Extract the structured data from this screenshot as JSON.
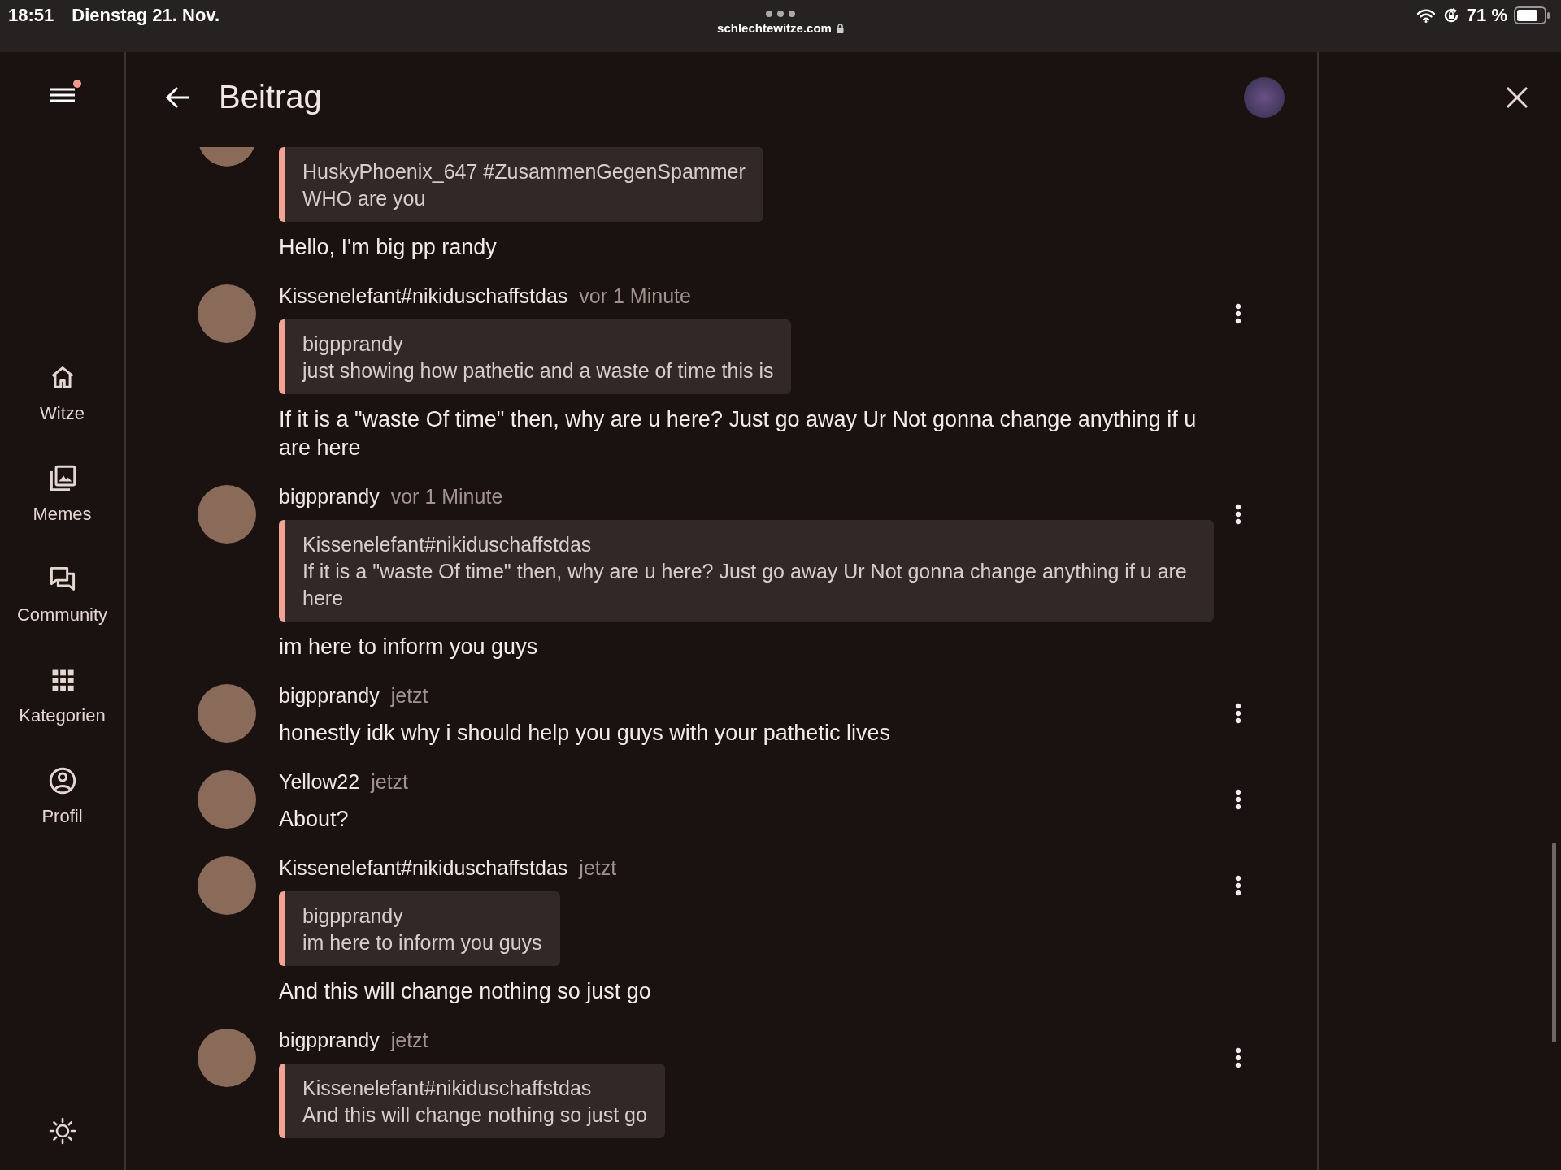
{
  "status_bar": {
    "time": "18:51",
    "date": "Dienstag 21. Nov.",
    "url": "schlechtewitze.com",
    "battery": "71 %"
  },
  "sidebar": {
    "menu_notification": true,
    "items": [
      {
        "kind": "home",
        "label": "Witze",
        "selected": false
      },
      {
        "kind": "memes",
        "label": "Memes",
        "selected": false
      },
      {
        "kind": "community",
        "label": "Community",
        "selected": false
      },
      {
        "kind": "categories",
        "label": "Kategorien",
        "selected": false
      },
      {
        "kind": "profile",
        "label": "Profil",
        "selected": false
      }
    ]
  },
  "header": {
    "title": "Beitrag"
  },
  "comments": [
    {
      "kind": "continued",
      "quote": {
        "author": "HuskyPhoenix_647 #ZusammenGegenSpammer",
        "text": "WHO are you"
      },
      "body": "Hello, I'm big pp randy"
    },
    {
      "kind": "comment",
      "author": "Kissenelefant#nikiduschaffstdas",
      "time": "vor 1 Minute",
      "quote": {
        "author": "bigpprandy",
        "text": "just showing how pathetic and a waste of time this is"
      },
      "body": "If it is a \"waste Of time\" then, why are u here? Just go away Ur Not gonna change anything if u are here"
    },
    {
      "kind": "comment",
      "author": "bigpprandy",
      "time": "vor 1 Minute",
      "quote": {
        "author": "Kissenelefant#nikiduschaffstdas",
        "text": "If it is a \"waste Of time\" then, why are u here? Just go away Ur Not gonna change anything if u are here"
      },
      "body": "im here to inform you guys"
    },
    {
      "kind": "comment",
      "author": "bigpprandy",
      "time": "jetzt",
      "body": "honestly idk why i should help you guys with your pathetic lives"
    },
    {
      "kind": "comment",
      "author": "Yellow22",
      "time": "jetzt",
      "body": "About?"
    },
    {
      "kind": "comment",
      "author": "Kissenelefant#nikiduschaffstdas",
      "time": "jetzt",
      "quote": {
        "author": "bigpprandy",
        "text": "im here to inform you guys"
      },
      "body": "And this will change nothing so just go"
    },
    {
      "kind": "comment",
      "author": "bigpprandy",
      "time": "jetzt",
      "quote": {
        "author": "Kissenelefant#nikiduschaffstdas",
        "text": "And this will change nothing so just go"
      }
    }
  ]
}
